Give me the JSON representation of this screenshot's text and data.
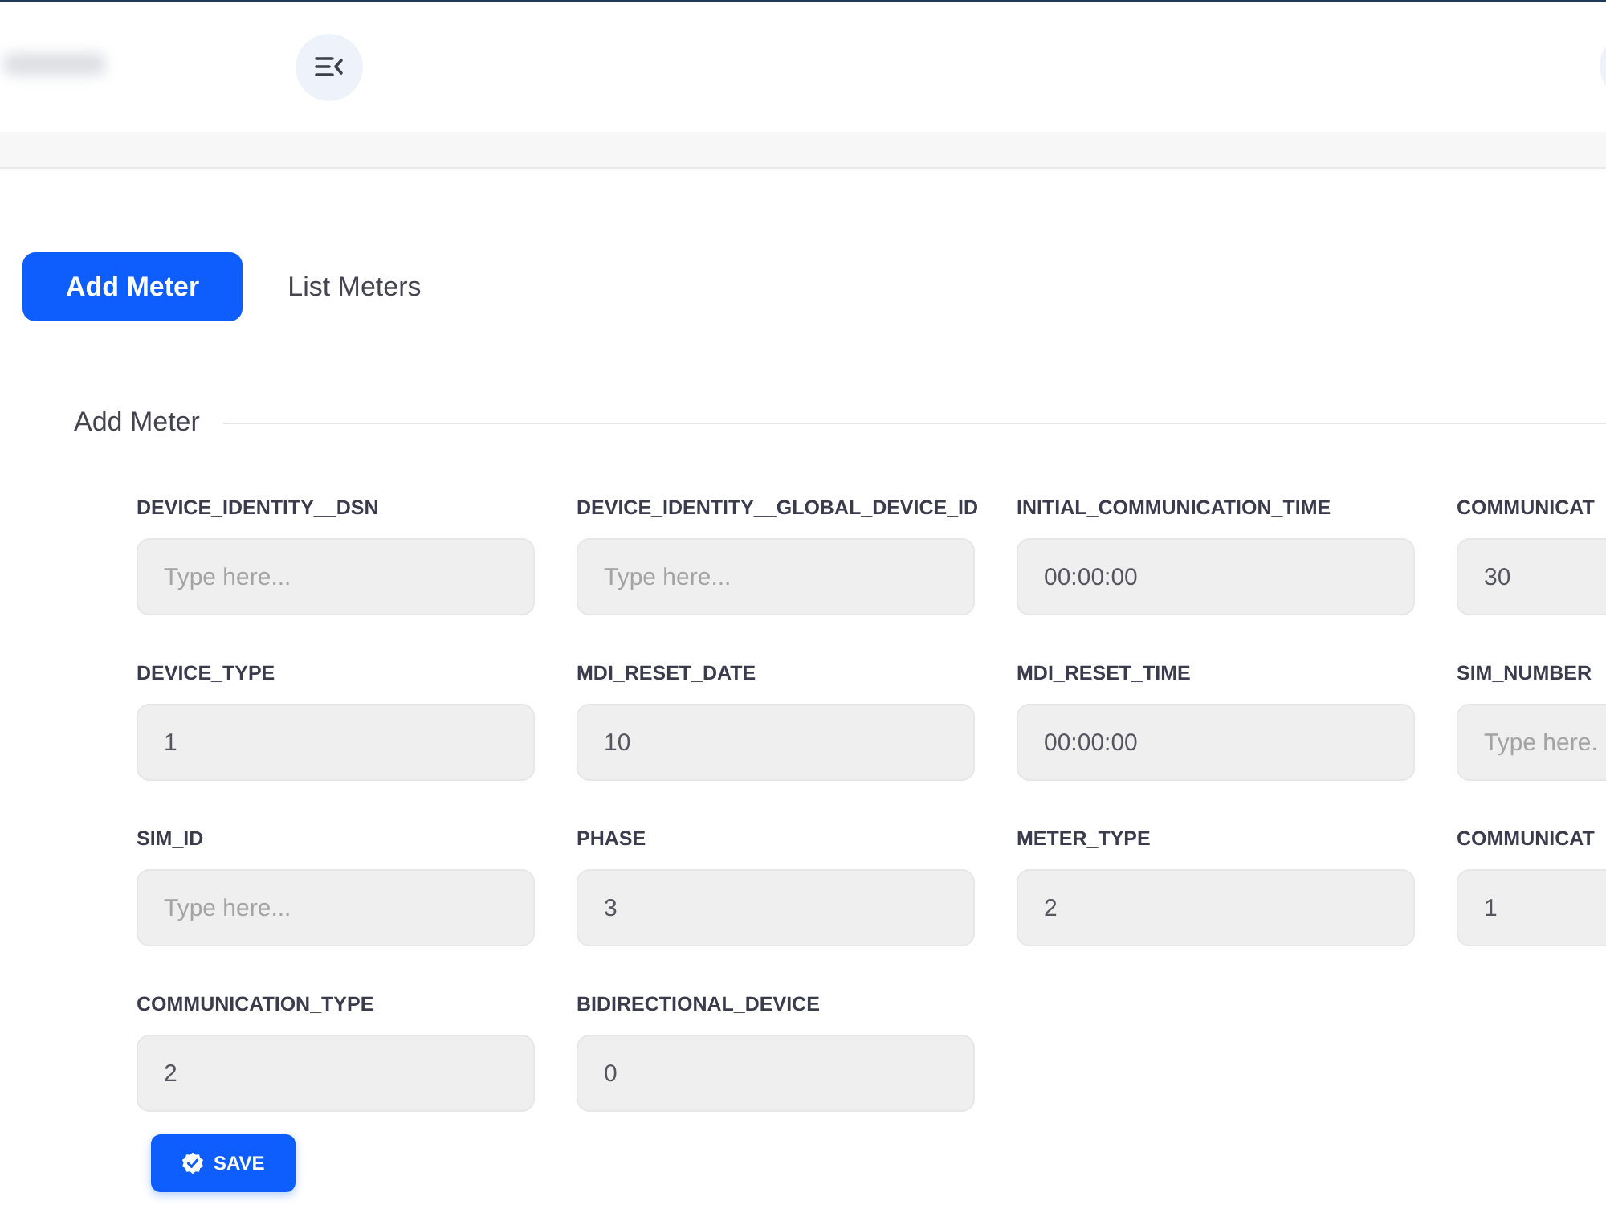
{
  "tabs": [
    {
      "label": "Add Meter",
      "selected": true
    },
    {
      "label": "List Meters",
      "selected": false
    }
  ],
  "form": {
    "title": "Add Meter",
    "fields": [
      {
        "label": "DEVICE_IDENTITY__DSN",
        "placeholder": "Type here..."
      },
      {
        "label": "DEVICE_IDENTITY__GLOBAL_DEVICE_ID",
        "placeholder": "Type here..."
      },
      {
        "label": "INITIAL_COMMUNICATION_TIME",
        "value": "00:00:00"
      },
      {
        "label": "COMMUNICAT",
        "value": "30"
      },
      {
        "label": "DEVICE_TYPE",
        "value": "1"
      },
      {
        "label": "MDI_RESET_DATE",
        "value": "10"
      },
      {
        "label": "MDI_RESET_TIME",
        "value": "00:00:00"
      },
      {
        "label": "SIM_NUMBER",
        "placeholder": "Type here."
      },
      {
        "label": "SIM_ID",
        "placeholder": "Type here..."
      },
      {
        "label": "PHASE",
        "value": "3"
      },
      {
        "label": "METER_TYPE",
        "value": "2"
      },
      {
        "label": "COMMUNICAT",
        "value": "1"
      },
      {
        "label": "COMMUNICATION_TYPE",
        "value": "2"
      },
      {
        "label": "BIDIRECTIONAL_DEVICE",
        "value": "0"
      }
    ],
    "save_button": "SAVE"
  }
}
